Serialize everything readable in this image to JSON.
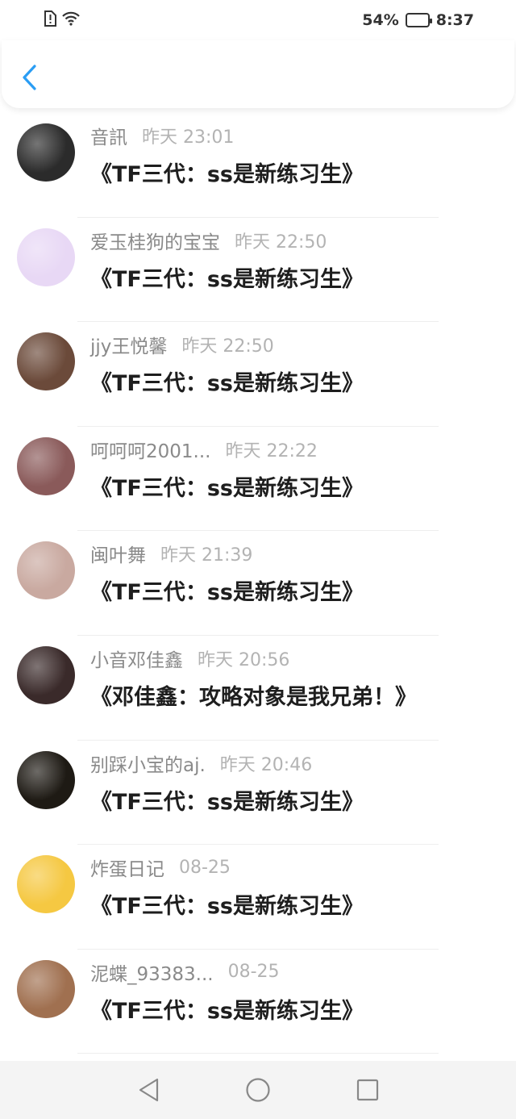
{
  "status_bar": {
    "battery": "54%",
    "battery_level": 0.54,
    "time": "8:37",
    "icons": [
      "alert-sim-icon",
      "wifi-icon",
      "battery-icon"
    ]
  },
  "header": {
    "back_icon": "chevron-left-icon",
    "accent": "#2a9df4"
  },
  "items": [
    {
      "name": "音訊",
      "time": "昨天 23:01",
      "title": "《TF三代：ss是新练习生》",
      "avatar_color": "#2b2b2b"
    },
    {
      "name": "爱玉桂狗的宝宝",
      "time": "昨天 22:50",
      "title": "《TF三代：ss是新练习生》",
      "avatar_color": "#e8d8f5"
    },
    {
      "name": "jjy王悦馨",
      "time": "昨天 22:50",
      "title": "《TF三代：ss是新练习生》",
      "avatar_color": "#6b4a3a"
    },
    {
      "name": "呵呵呵2001...",
      "time": "昨天 22:22",
      "title": "《TF三代：ss是新练习生》",
      "avatar_color": "#8a5a5a"
    },
    {
      "name": "闽叶舞",
      "time": "昨天 21:39",
      "title": "《TF三代：ss是新练习生》",
      "avatar_color": "#c9a9a0"
    },
    {
      "name": "小音邓佳鑫",
      "time": "昨天 20:56",
      "title": "《邓佳鑫：攻略对象是我兄弟！》",
      "avatar_color": "#3a2a2a"
    },
    {
      "name": "别踩小宝的aj.",
      "time": "昨天 20:46",
      "title": "《TF三代：ss是新练习生》",
      "avatar_color": "#1e1a14"
    },
    {
      "name": "炸蛋日记",
      "time": "08-25",
      "title": "《TF三代：ss是新练习生》",
      "avatar_color": "#f5c842"
    },
    {
      "name": "泥蝶_93383...",
      "time": "08-25",
      "title": "《TF三代：ss是新练习生》",
      "avatar_color": "#a07050"
    }
  ],
  "nav": {
    "icons": [
      "back-triangle-icon",
      "home-circle-icon",
      "recents-square-icon"
    ]
  }
}
